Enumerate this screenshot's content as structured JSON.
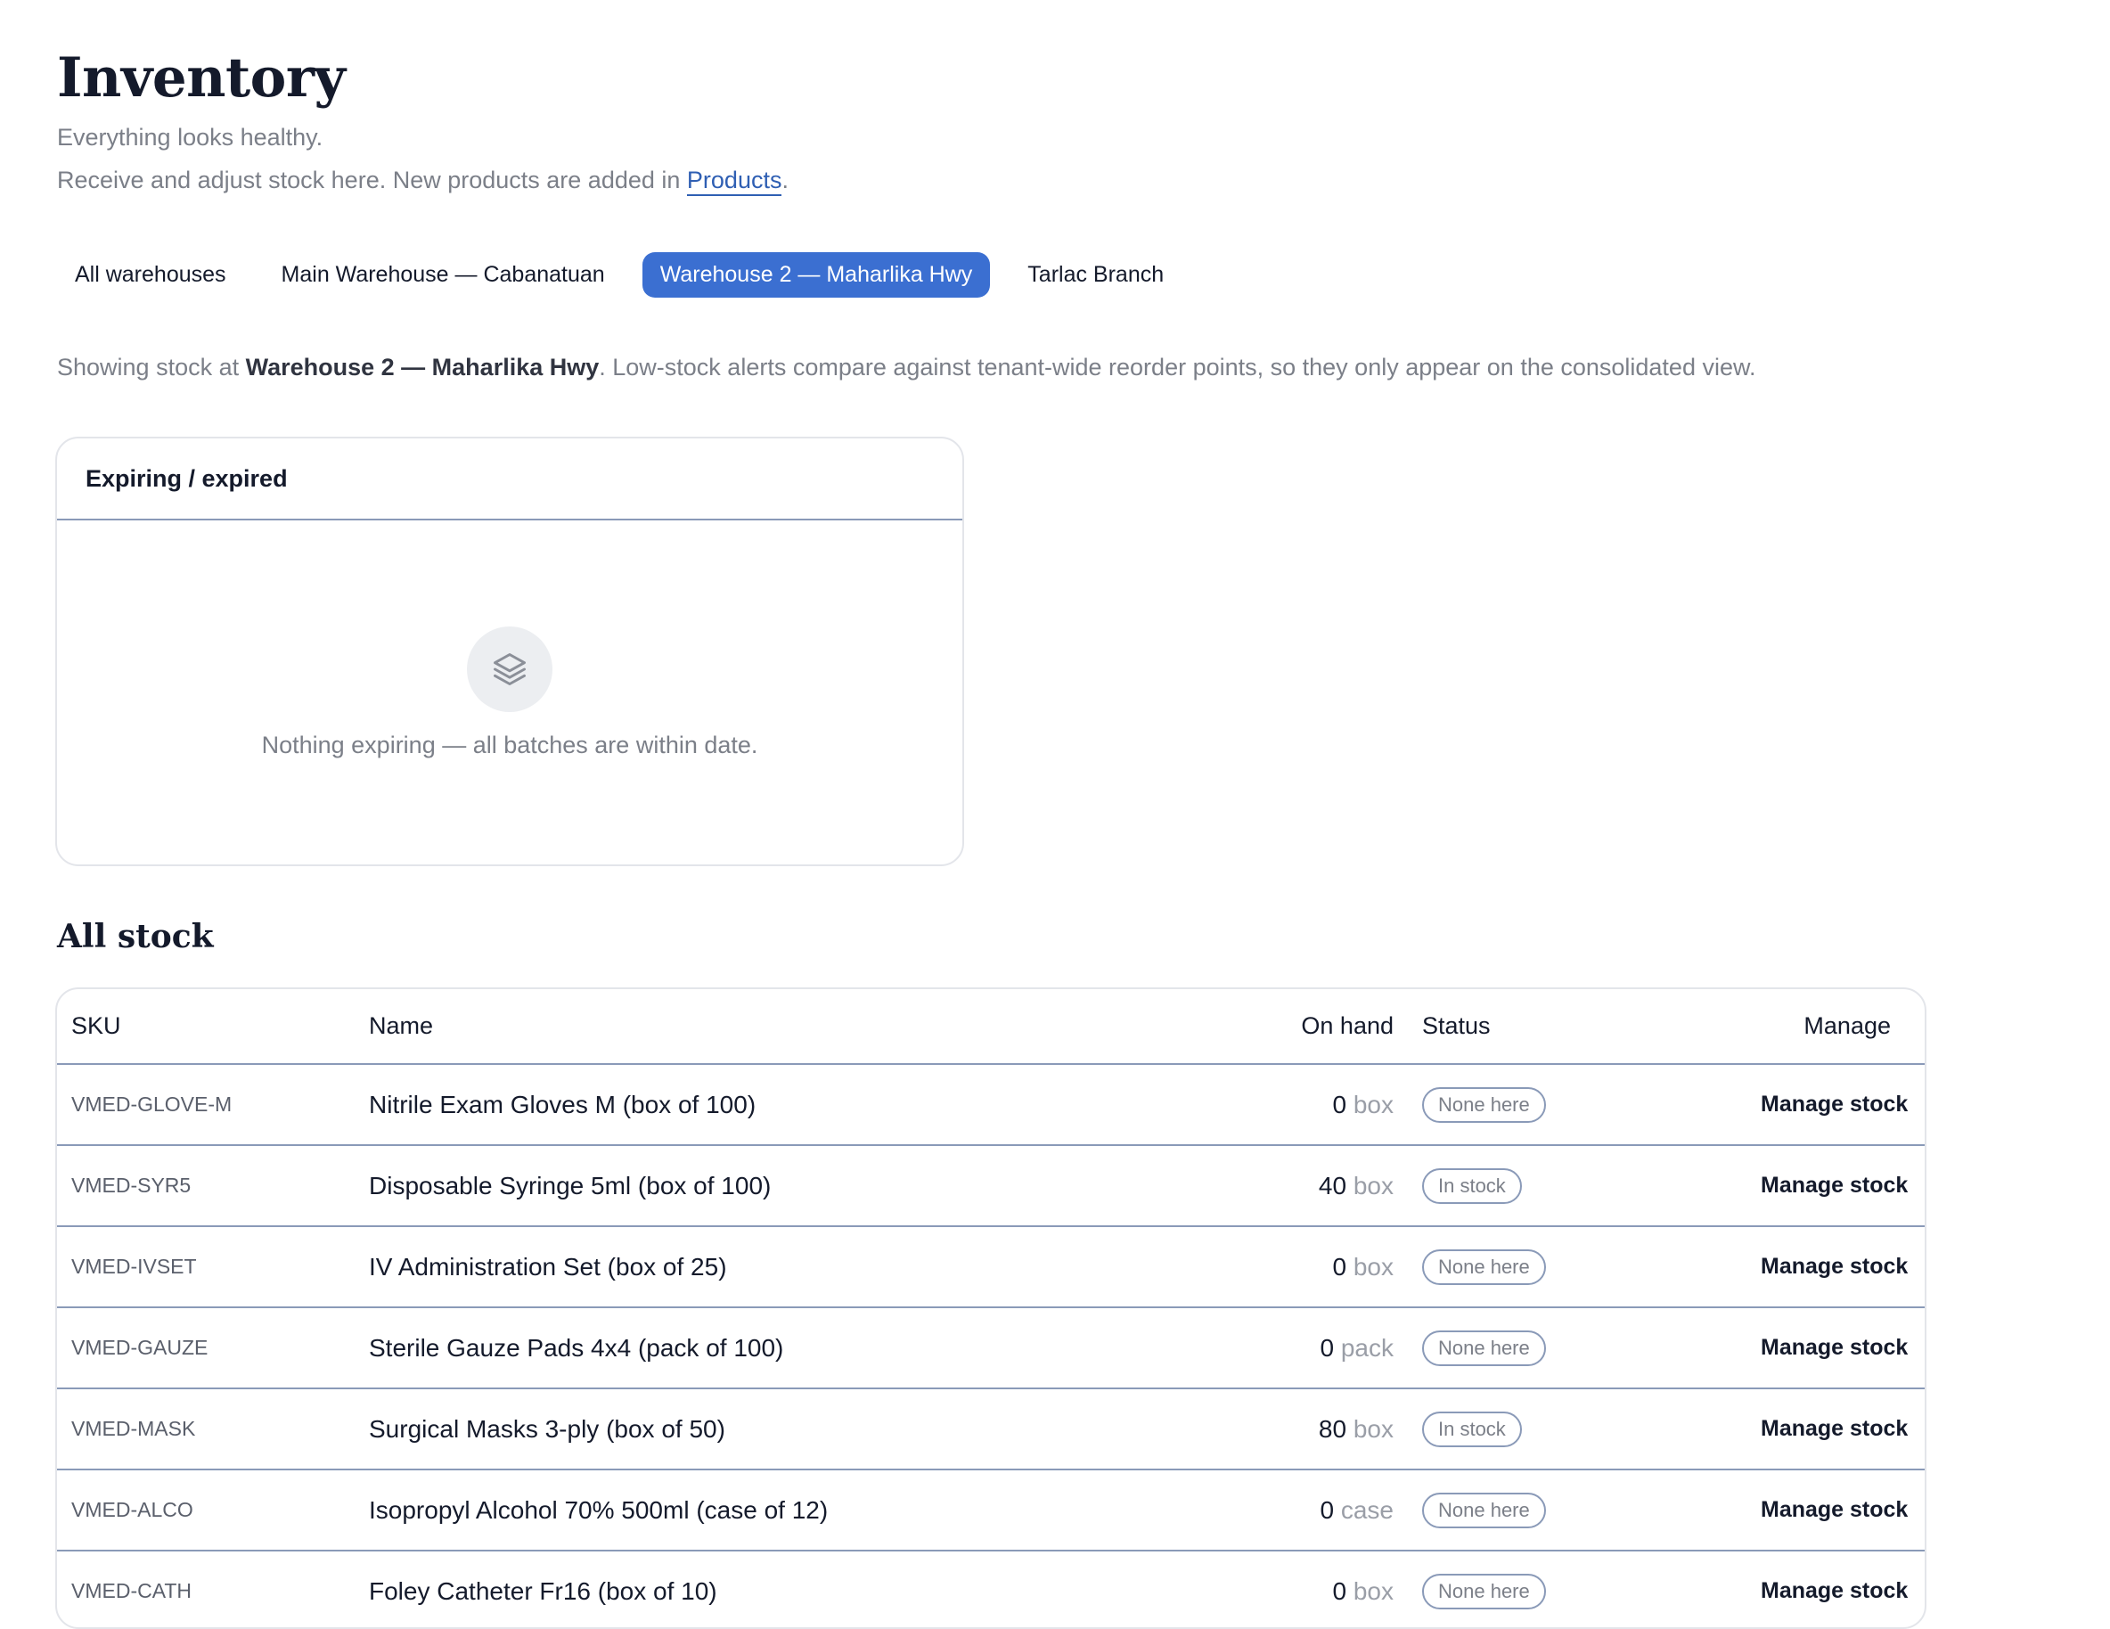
{
  "header": {
    "title": "Inventory",
    "subtitle": "Everything looks healthy.",
    "hint_prefix": "Receive and adjust stock here. New products are added in ",
    "hint_link": "Products",
    "hint_suffix": "."
  },
  "tabs": [
    {
      "label": "All warehouses",
      "active": false
    },
    {
      "label": "Main Warehouse — Cabanatuan",
      "active": false
    },
    {
      "label": "Warehouse 2 — Maharlika Hwy",
      "active": true
    },
    {
      "label": "Tarlac Branch",
      "active": false
    }
  ],
  "scope_note": {
    "prefix": "Showing stock at ",
    "warehouse": "Warehouse 2 — Maharlika Hwy",
    "suffix": ". Low-stock alerts compare against tenant-wide reorder points, so they only appear on the consolidated view."
  },
  "expiring_card": {
    "title": "Expiring / expired",
    "icon": "layers-icon",
    "empty_text": "Nothing expiring — all batches are within date."
  },
  "stock_section": {
    "title": "All stock",
    "columns": {
      "sku": "SKU",
      "name": "Name",
      "on_hand": "On hand",
      "status": "Status",
      "manage": "Manage"
    },
    "rows": [
      {
        "sku": "VMED-GLOVE-M",
        "name": "Nitrile Exam Gloves M (box of 100)",
        "qty": "0",
        "unit": "box",
        "status": "None here",
        "action": "Manage stock"
      },
      {
        "sku": "VMED-SYR5",
        "name": "Disposable Syringe 5ml (box of 100)",
        "qty": "40",
        "unit": "box",
        "status": "In stock",
        "action": "Manage stock"
      },
      {
        "sku": "VMED-IVSET",
        "name": "IV Administration Set (box of 25)",
        "qty": "0",
        "unit": "box",
        "status": "None here",
        "action": "Manage stock"
      },
      {
        "sku": "VMED-GAUZE",
        "name": "Sterile Gauze Pads 4x4 (pack of 100)",
        "qty": "0",
        "unit": "pack",
        "status": "None here",
        "action": "Manage stock"
      },
      {
        "sku": "VMED-MASK",
        "name": "Surgical Masks 3-ply (box of 50)",
        "qty": "80",
        "unit": "box",
        "status": "In stock",
        "action": "Manage stock"
      },
      {
        "sku": "VMED-ALCO",
        "name": "Isopropyl Alcohol 70% 500ml (case of 12)",
        "qty": "0",
        "unit": "case",
        "status": "None here",
        "action": "Manage stock"
      },
      {
        "sku": "VMED-CATH",
        "name": "Foley Catheter Fr16 (box of 10)",
        "qty": "0",
        "unit": "box",
        "status": "None here",
        "action": "Manage stock"
      }
    ]
  },
  "colors": {
    "accent": "#3b6fd1",
    "link": "#2f5fb3",
    "muted_text": "#7b7f88",
    "divider": "#8a9ab8"
  }
}
